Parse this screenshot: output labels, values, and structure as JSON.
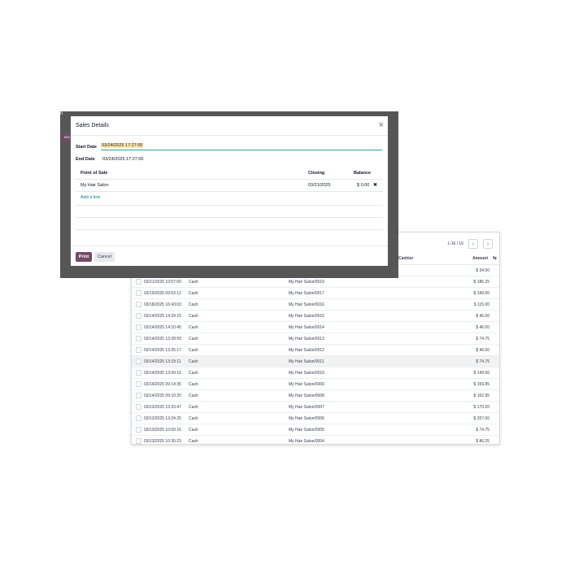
{
  "list": {
    "pager_text": "1-16 / 16",
    "prev_icon": "chevron-left-icon",
    "next_icon": "chevron-right-icon",
    "header_cashier": "Cashier",
    "header_amount": "Amount",
    "sort_icon": "sort-arrows-icon",
    "rows": [
      {
        "date": "",
        "payment": "",
        "ref": "",
        "amount": "$ 34.50"
      },
      {
        "date": "03/21/2025 10:57:00",
        "payment": "Cash",
        "ref": "My Hair Salon/0019",
        "amount": "$ 186.25"
      },
      {
        "date": "03/19/2025 09:53:12",
        "payment": "Cash",
        "ref": "My Hair Salon/0017",
        "amount": "$ 149.50"
      },
      {
        "date": "03/18/2025 16:43:03",
        "payment": "Cash",
        "ref": "My Hair Salon/0016",
        "amount": "$ 115.00"
      },
      {
        "date": "03/14/2025 14:29:15",
        "payment": "Cash",
        "ref": "My Hair Salon/0015",
        "amount": "$ 46.00"
      },
      {
        "date": "03/14/2025 14:10:45",
        "payment": "Cash",
        "ref": "My Hair Salon/0014",
        "amount": "$ 46.00"
      },
      {
        "date": "03/14/2025 13:28:59",
        "payment": "Cash",
        "ref": "My Hair Salon/0013",
        "amount": "$ 74.75"
      },
      {
        "date": "03/14/2025 13:25:17",
        "payment": "Cash",
        "ref": "My Hair Salon/0012",
        "amount": "$ 46.00"
      },
      {
        "date": "03/14/2025 13:19:11",
        "payment": "Cash",
        "ref": "My Hair Salon/0011",
        "amount": "$ 74.75"
      },
      {
        "date": "03/14/2025 13:09:10",
        "payment": "Cash",
        "ref": "My Hair Salon/0010",
        "amount": "$ 149.50"
      },
      {
        "date": "03/14/2025 09:14:35",
        "payment": "Cash",
        "ref": "My Hair Salon/0009",
        "amount": "$ 159.85"
      },
      {
        "date": "03/14/2025 09:10:20",
        "payment": "Cash",
        "ref": "My Hair Salon/0008",
        "amount": "$ 162.95"
      },
      {
        "date": "03/13/2025 15:33:47",
        "payment": "Cash",
        "ref": "My Hair Salon/0007",
        "amount": "$ 170.20"
      },
      {
        "date": "03/13/2025 13:24:25",
        "payment": "Cash",
        "ref": "My Hair Salon/0006",
        "amount": "$ 207.00"
      },
      {
        "date": "03/13/2025 10:50:16",
        "payment": "Cash",
        "ref": "My Hair Salon/0005",
        "amount": "$ 74.75"
      },
      {
        "date": "03/13/2025 10:35:23",
        "payment": "Cash",
        "ref": "My Hair Salon/0004",
        "amount": "$ 86.25"
      }
    ]
  },
  "overlay": {
    "side_letter": "n",
    "side_tab": "ING"
  },
  "modal": {
    "title": "Sales Details",
    "close_icon": "close-icon",
    "start_label": "Start Date",
    "start_value": "03/24/2025 17:27:00",
    "end_label": "End Date",
    "end_value": "03/24/2025 17:27:00",
    "col_pos": "Point of Sale",
    "col_closing": "Closing",
    "col_balance": "Balance",
    "row_pos": "My Hair Salon",
    "row_closing": "03/21/2025",
    "row_balance": "$ 0.00",
    "delete_icon": "delete-x-icon",
    "add_line": "Add a line",
    "print_label": "Print",
    "cancel_label": "Cancel"
  },
  "colors": {
    "primary": "#714b67",
    "link": "#017e84",
    "highlight": "#fde9a9"
  }
}
